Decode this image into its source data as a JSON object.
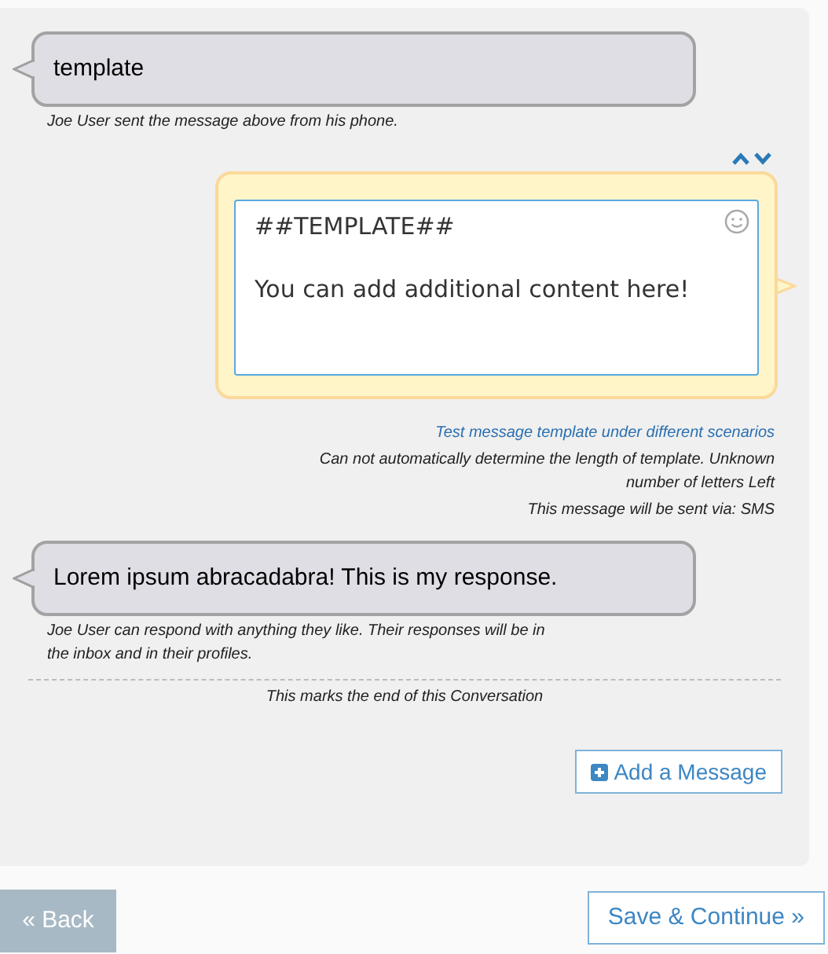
{
  "messages": [
    {
      "kind": "incoming",
      "text": "template",
      "caption": "Joe User sent the message above from his phone."
    },
    {
      "kind": "outgoing",
      "value": "##TEMPLATE##\n\nYou can add additional content here!",
      "link": "Test message template under different scenarios",
      "notes": [
        "Can not automatically determine the length of template. Unknown number of letters Left",
        "This message will be sent via: SMS"
      ]
    },
    {
      "kind": "incoming",
      "text": "Lorem ipsum abracadabra! This is my response.",
      "caption": "Joe User can respond with anything they like. Their responses will be in the inbox and in their profiles."
    }
  ],
  "end_note": "This marks the end of this Conversation",
  "add_button": "Add a Message",
  "back_button": "« Back",
  "save_button": "Save & Continue »"
}
